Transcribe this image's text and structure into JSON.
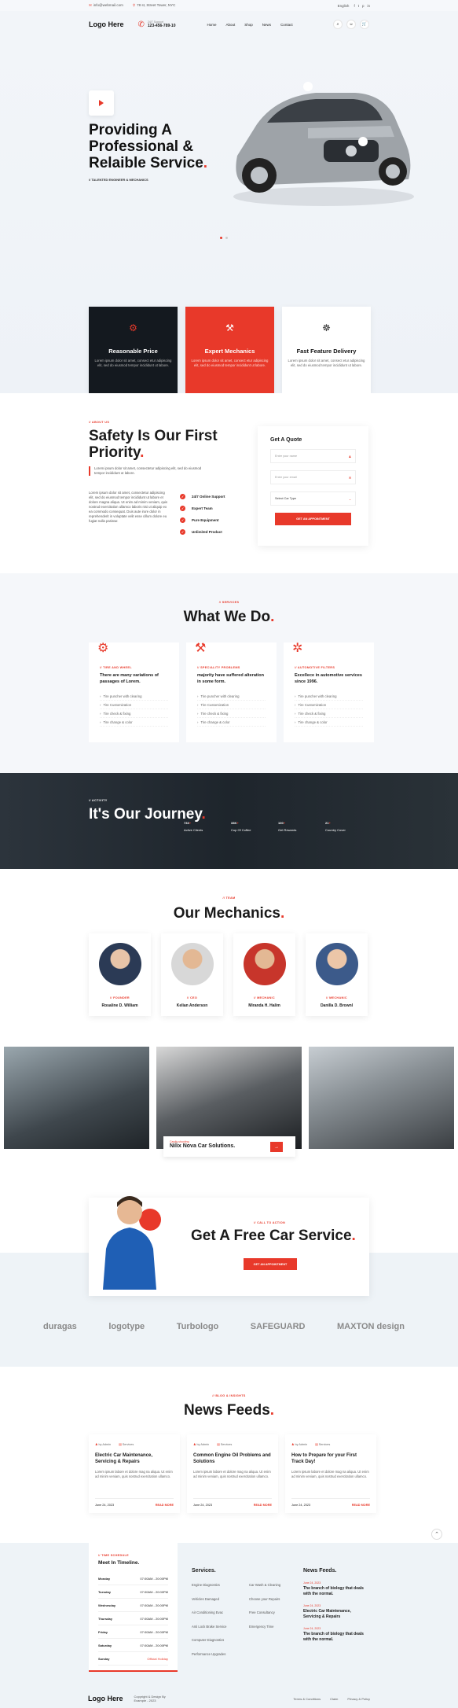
{
  "topbar": {
    "email": "info@webmail.com",
    "address": "78 st, Street Tower, NYC",
    "language": "English",
    "social": [
      "f",
      "t",
      "p",
      "in"
    ]
  },
  "header": {
    "logo": "Logo Here",
    "support_label": "24/7 Support",
    "support_phone": "123-456-789-10",
    "nav": [
      "Home",
      "About",
      "Shop",
      "News",
      "Contact"
    ],
    "cart_count": "0"
  },
  "hero": {
    "title": "Providing A Professional & Relaible Service",
    "subtitle": "// TALENTED ENGINEER & MECHANICS"
  },
  "features": [
    {
      "title": "Reasonable Price",
      "text": "Lorem ipsum dolor sit amet, consect etur adipiscing elit, sed do eiusmod tempor incididunt ut labore."
    },
    {
      "title": "Expert Mechanics",
      "text": "Lorem ipsum dolor sit amet, consect etur adipiscing elit, sed do eiusmod tempor incididunt ut labore."
    },
    {
      "title": "Fast Feature Delivery",
      "text": "Lorem ipsum dolor sit amet, consect etur adipiscing elit, sed do eiusmod tempor incididunt ut labore."
    }
  ],
  "about": {
    "tag": "// ABOUT US",
    "title": "Safety Is Our First Priority",
    "lead": "Lorem ipsum dolor sit amet, consectetur adipiscing elit, sed do eiusmod tempor incididunt ut labore.",
    "body": "Lorem ipsum dolor sit amet, consectetur adipiscing elit, sed do eiusmod tempor incididunt ut labore et dolore magna aliqua. Ut enim ad minim veniam, quis nostrud exercitation ullamco laboris nisi ut aliquip ex ea commodo consequat. Duis aute irure dolor in reprehenderit in voluptate velit esse cillum dolore eu fugiat nulla pariatur.",
    "checks": [
      "24/7 Online Support",
      "Expert Team",
      "Pure Equipment",
      "Unlimited Product"
    ]
  },
  "quote": {
    "title": "Get A Quote",
    "name_ph": "Enter your name",
    "email_ph": "Enter your email",
    "car_type": "Select Car Type",
    "button": "GET AN APPOINTMENT"
  },
  "services": {
    "tag": "// SERVICES",
    "title": "What We Do",
    "cards": [
      {
        "tag": "// TIRE AND WHEEL",
        "title": "There are many variations of passages of Lorem.",
        "items": [
          "Tire puncher with clearing",
          "Tire Customization",
          "Tire check & fixing",
          "Tire change & color"
        ]
      },
      {
        "tag": "// SPECIALITY PROBLEMS",
        "title": "majority have suffered alteration in some form.",
        "items": [
          "Tire puncher with clearing",
          "Tire Customization",
          "Tire check & fixing",
          "Tire change & color"
        ]
      },
      {
        "tag": "// AUTOMOTIVE FILTERS",
        "title": "Excellece in automotive services since 1996.",
        "items": [
          "Tire puncher with clearing",
          "Tire Customization",
          "Tire check & fixing",
          "Tire change & color"
        ]
      }
    ]
  },
  "journey": {
    "tag": "// ACTIVITY",
    "title": "It's Our Journey",
    "stats": [
      {
        "value": "733",
        "label": "Active Clients"
      },
      {
        "value": "33K",
        "label": "Cup Of Coffee"
      },
      {
        "value": "100",
        "label": "Get Rewards"
      },
      {
        "value": "21",
        "label": "Country Cover"
      }
    ]
  },
  "mechanics": {
    "tag": "// TEAM",
    "title": "Our Mechanics",
    "people": [
      {
        "role": "// FOUNDER",
        "name": "Rosaline D. William"
      },
      {
        "role": "// CEO",
        "name": "Kelian Anderson"
      },
      {
        "role": "// MECHANIC",
        "name": "Miranda H. Halim"
      },
      {
        "role": "// MECHANIC",
        "name": "Danilla D. Brownl"
      }
    ]
  },
  "gallery": {
    "caption_tag": "Cardio shooting",
    "caption": "Nilix Nova Car Solutions."
  },
  "cta": {
    "tag": "// CALL TO ACTION",
    "title": "Get A Free Car Service",
    "button": "GET AN APPOINTMENT"
  },
  "brands": [
    "duragas",
    "logotype",
    "Turbologo",
    "SAFEGUARD",
    "MAXTON design"
  ],
  "news": {
    "tag": "// BLOG & INSIGHTS",
    "title": "News Feeds",
    "posts": [
      {
        "author": "by Admin",
        "cat": "Services",
        "title": "Electric Car Maintenance, Servicing & Repairs",
        "text": "Lorem ipsum labore et dolore mag na aliqua. Ut enim ad minim veniam, quis nostrud exercitation ullamco.",
        "date": "June 24, 2023",
        "more": "READ MORE"
      },
      {
        "author": "by Admin",
        "cat": "Services",
        "title": "Common Engine Oil Problems and Solutions",
        "text": "Lorem ipsum labore et dolore mag na aliqua. Ut enim ad minim veniam, quis nostrud exercitation ullamco.",
        "date": "June 24, 2023",
        "more": "READ MORE"
      },
      {
        "author": "by Admin",
        "cat": "Services",
        "title": "How to Prepare for your First Track Day!",
        "text": "Lorem ipsum labore et dolore mag na aliqua. Ut enim ad minim veniam, quis nostrud exercitation ullamco.",
        "date": "June 24, 2023",
        "more": "READ MORE"
      }
    ]
  },
  "footer": {
    "time_tag": "// TIME SCHEDULE",
    "time_title": "Meet In Timeline.",
    "times": [
      {
        "day": "Monday",
        "time": "07:00AM - 20:00PM"
      },
      {
        "day": "Tuesday",
        "time": "07:00AM - 20:00PM"
      },
      {
        "day": "Wednesday",
        "time": "07:00AM - 20:00PM"
      },
      {
        "day": "Thursday",
        "time": "07:00AM - 20:00PM"
      },
      {
        "day": "Friday",
        "time": "07:00AM - 20:00PM"
      },
      {
        "day": "Saturday",
        "time": "07:00AM - 20:00PM"
      },
      {
        "day": "Sunday",
        "time": "Official Holiday"
      }
    ],
    "services_title": "Services.",
    "services_a": [
      "Engine Diagnostics",
      "Vehicles Damaged",
      "Air Conditioning Evac",
      "Anti Lock Brake Service",
      "Computer Diagnostics",
      "Performance Upgrades"
    ],
    "services_b": [
      "Car Wash & Cleaning",
      "Choose your Repairs",
      "Free Consultancy",
      "Emergency Time"
    ],
    "news_title": "News Feeds.",
    "news": [
      {
        "date": "June 24, 2023",
        "title": "The branch of biology that deals with the normal."
      },
      {
        "date": "June 24, 2023",
        "title": "Electric Car Maintenance, Servicing & Repairs"
      },
      {
        "date": "June 24, 2023",
        "title": "The branch of biology that deals with the normal."
      }
    ],
    "logo": "Logo Here",
    "copyright": "Copyright & Design By Example - 2023",
    "links": [
      "Terms & Conditions",
      "Claim",
      "Privacy & Policy"
    ]
  },
  "colors": {
    "accent": "#e8392a",
    "dark": "#14191f"
  }
}
